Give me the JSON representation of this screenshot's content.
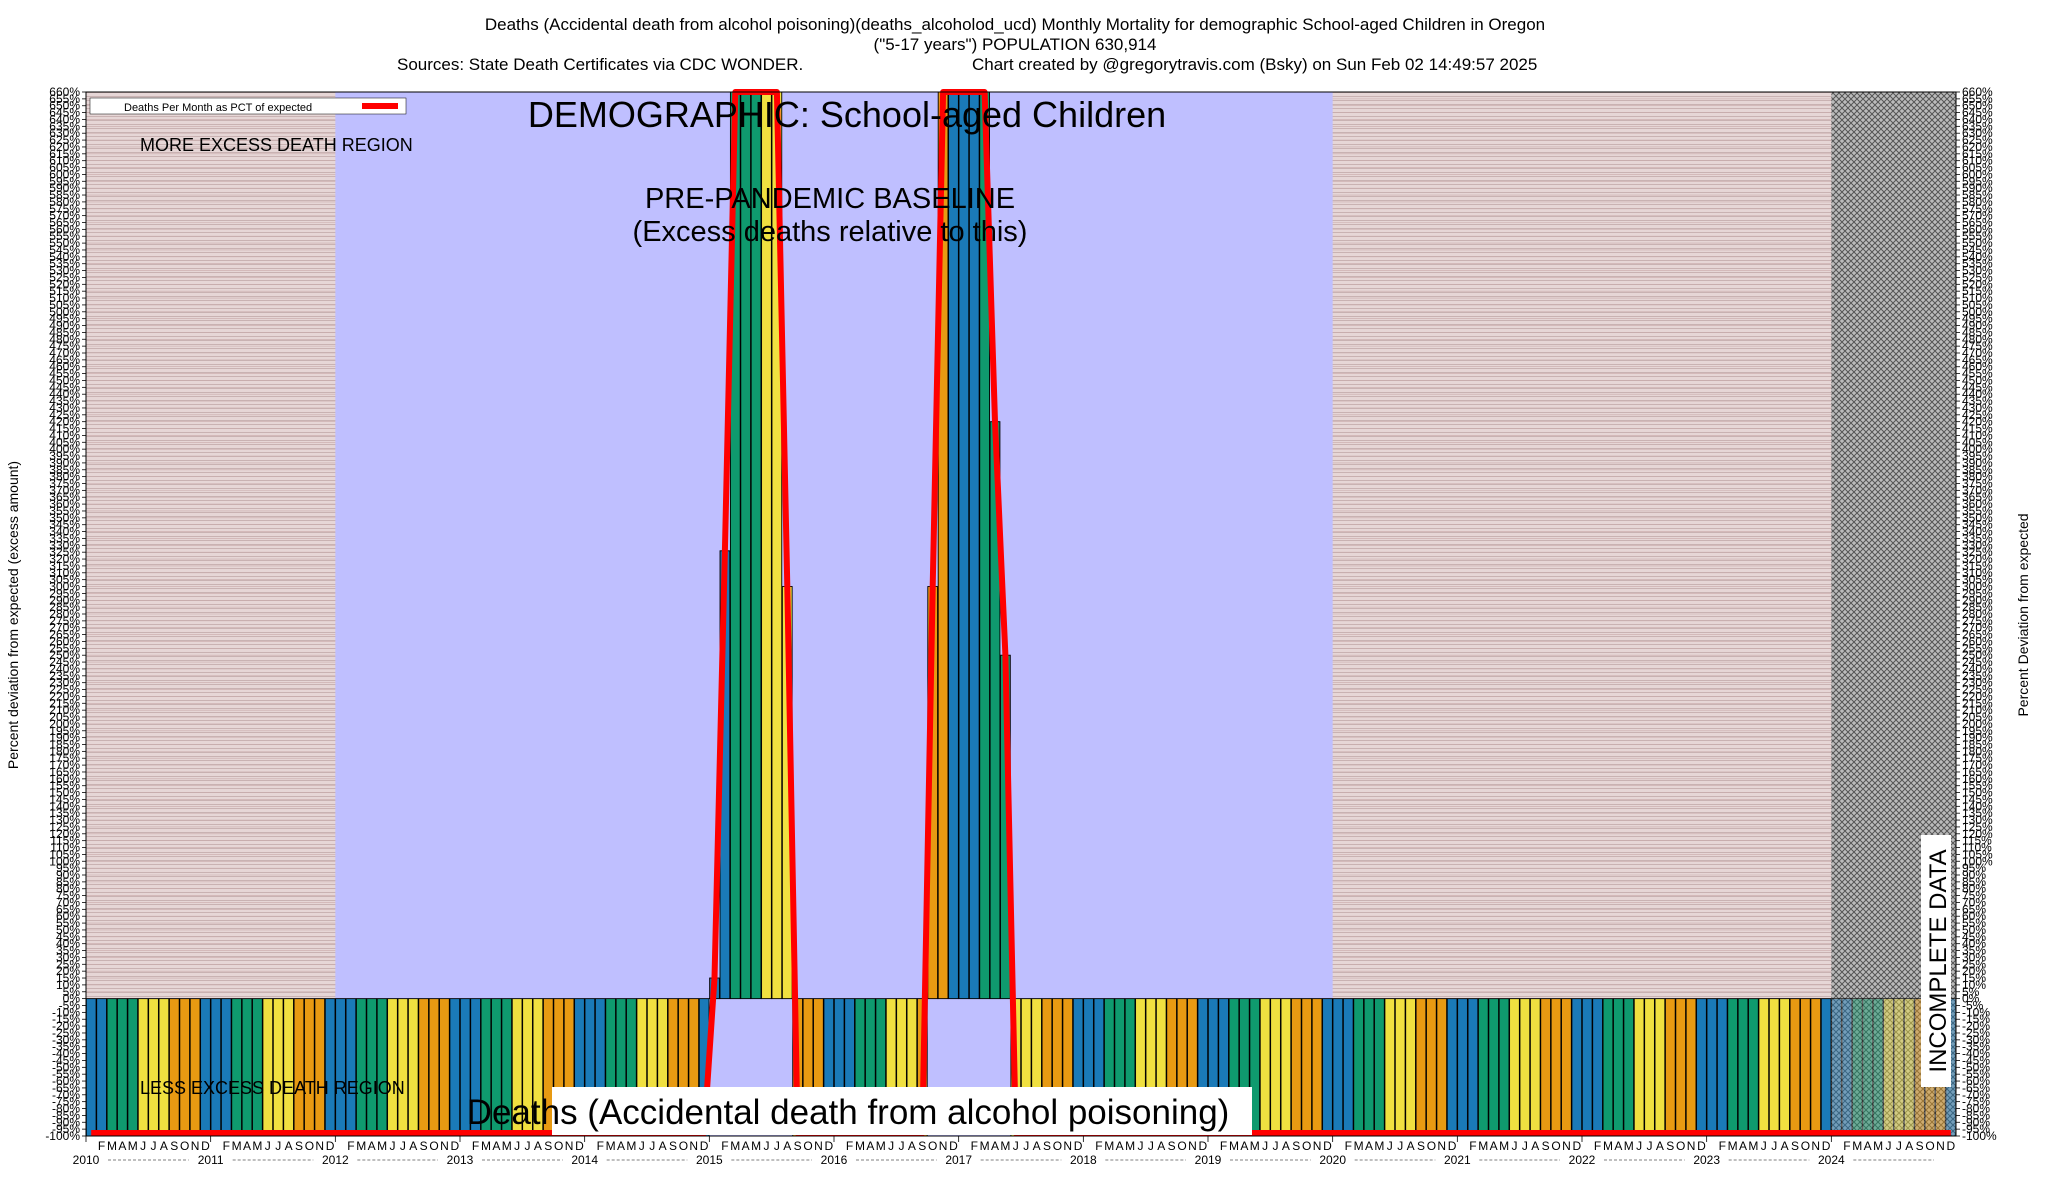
{
  "chart_data": {
    "type": "bar",
    "title_line1": "Deaths (Accidental death from alcohol poisoning)(deaths_alcoholod_ucd) Monthly Mortality for demographic School-aged Children in Oregon",
    "title_line2": "(\"5-17 years\") POPULATION 630,914",
    "title_line3_left": "Sources: State Death Certificates via CDC WONDER.",
    "title_line3_right": "Chart created by @gregorytravis.com (Bsky) on Sun Feb 02 14:49:57 2025",
    "ylabel_left": "Percent deviation from expected (excess amount)",
    "ylabel_right": "Percent Deviation from expected",
    "ylim": [
      -100,
      660
    ],
    "ytick_step": 5,
    "legend_label": "Deaths Per Month as PCT of expected",
    "legend_position": "top-left",
    "annotations": {
      "demographic": "DEMOGRAPHIC: School-aged Children",
      "more_excess": "MORE EXCESS DEATH REGION",
      "baseline_line1": "PRE-PANDEMIC BASELINE",
      "baseline_line2": "(Excess deaths relative to this)",
      "less_excess": "LESS EXCESS DEATH REGION",
      "cause_label": "Deaths (Accidental death from alcohol poisoning)",
      "incomplete": "INCOMPLETE DATA"
    },
    "baseline_period": [
      "2012-01",
      "2019-12"
    ],
    "incomplete_period": [
      "2024-02",
      "2024-12"
    ],
    "years": [
      "2010",
      "2011",
      "2012",
      "2013",
      "2014",
      "2015",
      "2016",
      "2017",
      "2018",
      "2019",
      "2020",
      "2021",
      "2022",
      "2023",
      "2024"
    ],
    "month_letters": [
      "J",
      "F",
      "M",
      "A",
      "M",
      "J",
      "J",
      "A",
      "S",
      "O",
      "N",
      "D"
    ],
    "season_colors": {
      "winter": "#1a7ab8",
      "spring": "#0f9a6e",
      "summer": "#f0e040",
      "autumn": "#e89a12"
    },
    "line_color": "#ff0000",
    "baseline_color": "#bfbfff",
    "region_color": "#e0d0d0",
    "spikes": [
      {
        "start": "2015-01",
        "values": [
          15,
          326,
          660,
          660,
          660,
          660,
          660,
          300
        ]
      },
      {
        "start": "2016-10",
        "values": [
          300,
          660,
          660,
          660,
          660,
          660,
          420,
          250
        ]
      }
    ],
    "default_value": -100
  }
}
